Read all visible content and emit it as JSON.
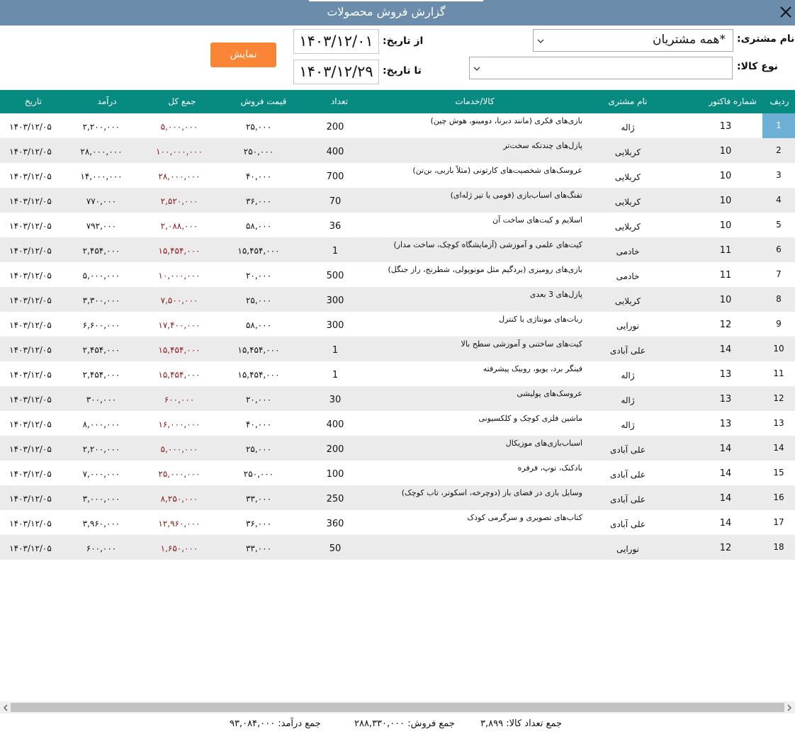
{
  "window": {
    "title": "گزارش فروش محصولات",
    "close_icon": "close-icon"
  },
  "filters": {
    "customer_label": "نام مشتری:",
    "customer_value": "*همه مشتریان",
    "product_type_label": "نوع کالا:",
    "product_type_value": "",
    "from_date_label": "از تاریخ:",
    "from_date_value": "۱۴۰۳/۱۲/۰۱",
    "to_date_label": "تا تاریخ:",
    "to_date_value": "۱۴۰۳/۱۲/۲۹",
    "show_button": "نمایش"
  },
  "table": {
    "headers": {
      "radif": "ردیف",
      "invoice": "شماره فاکتور",
      "customer": "نام مشتری",
      "product": "کالا/خدمات",
      "qty": "تعداد",
      "price": "قیمت فروش",
      "total": "جمع کل",
      "income": "درآمد",
      "date": "تاریخ"
    },
    "selected_row": 0,
    "rows": [
      {
        "radif": "1",
        "invoice": "13",
        "customer": "ژاله",
        "product": "بازی‌های فکری (مانند دبرنا، دومینو، هوش چین)",
        "qty": "200",
        "price": "۲۵,۰۰۰",
        "total": "۵,۰۰۰,۰۰۰",
        "income": "۲,۲۰۰,۰۰۰",
        "date": "۱۴۰۳/۱۲/۰۵"
      },
      {
        "radif": "2",
        "invoice": "10",
        "customer": "کربلایی",
        "product": "پازل‌های چندتکه سخت‌تر",
        "qty": "400",
        "price": "۲۵۰,۰۰۰",
        "total": "۱۰۰,۰۰۰,۰۰۰",
        "income": "۲۸,۰۰۰,۰۰۰",
        "date": "۱۴۰۳/۱۲/۰۵"
      },
      {
        "radif": "3",
        "invoice": "10",
        "customer": "کربلایی",
        "product": "عروسک‌های شخصیت‌های کارتونی (مثلاً باربی، بن‌تن)",
        "qty": "700",
        "price": "۴۰,۰۰۰",
        "total": "۲۸,۰۰۰,۰۰۰",
        "income": "۱۴,۰۰۰,۰۰۰",
        "date": "۱۴۰۳/۱۲/۰۵"
      },
      {
        "radif": "4",
        "invoice": "10",
        "customer": "کربلایی",
        "product": "تفنگ‌های اسباب‌بازی (فومی یا تیر ژله‌ای)",
        "qty": "70",
        "price": "۳۶,۰۰۰",
        "total": "۲,۵۲۰,۰۰۰",
        "income": "۷۷۰,۰۰۰",
        "date": "۱۴۰۳/۱۲/۰۵"
      },
      {
        "radif": "5",
        "invoice": "10",
        "customer": "کربلایی",
        "product": "اسلایم و کیت‌های ساخت آن",
        "qty": "36",
        "price": "۵۸,۰۰۰",
        "total": "۲,۰۸۸,۰۰۰",
        "income": "۷۹۲,۰۰۰",
        "date": "۱۴۰۳/۱۲/۰۵"
      },
      {
        "radif": "6",
        "invoice": "11",
        "customer": "خادمی",
        "product": "کیت‌های علمی و آموزشی (آزمایشگاه کوچک، ساخت مدار)",
        "qty": "1",
        "price": "۱۵,۴۵۴,۰۰۰",
        "total": "۱۵,۴۵۴,۰۰۰",
        "income": "۲,۴۵۴,۰۰۰",
        "date": "۱۴۰۳/۱۲/۰۵"
      },
      {
        "radif": "7",
        "invoice": "11",
        "customer": "خادمی",
        "product": "بازی‌های رومیزی (بردگیم مثل مونوپولی، شطرنج، راز جنگل)",
        "qty": "500",
        "price": "۲۰,۰۰۰",
        "total": "۱۰,۰۰۰,۰۰۰",
        "income": "۵,۰۰۰,۰۰۰",
        "date": "۱۴۰۳/۱۲/۰۵"
      },
      {
        "radif": "8",
        "invoice": "10",
        "customer": "کربلایی",
        "product": "پازل‌های 3 بعدی",
        "qty": "300",
        "price": "۲۵,۰۰۰",
        "total": "۷,۵۰۰,۰۰۰",
        "income": "۳,۳۰۰,۰۰۰",
        "date": "۱۴۰۳/۱۲/۰۵"
      },
      {
        "radif": "9",
        "invoice": "12",
        "customer": "نورایی",
        "product": "ربات‌های مونتاژی با کنترل",
        "qty": "300",
        "price": "۵۸,۰۰۰",
        "total": "۱۷,۴۰۰,۰۰۰",
        "income": "۶,۶۰۰,۰۰۰",
        "date": "۱۴۰۳/۱۲/۰۵"
      },
      {
        "radif": "10",
        "invoice": "14",
        "customer": "علی آبادی",
        "product": "کیت‌های ساختنی و آموزشی سطح بالا",
        "qty": "1",
        "price": "۱۵,۴۵۴,۰۰۰",
        "total": "۱۵,۴۵۴,۰۰۰",
        "income": "۲,۴۵۴,۰۰۰",
        "date": "۱۴۰۳/۱۲/۰۵"
      },
      {
        "radif": "11",
        "invoice": "13",
        "customer": "ژاله",
        "product": "فینگر برد، یویو، روبیک پیشرفته",
        "qty": "1",
        "price": "۱۵,۴۵۴,۰۰۰",
        "total": "۱۵,۴۵۴,۰۰۰",
        "income": "۲,۴۵۴,۰۰۰",
        "date": "۱۴۰۳/۱۲/۰۵"
      },
      {
        "radif": "12",
        "invoice": "13",
        "customer": "ژاله",
        "product": "عروسک‌های پولیشی",
        "qty": "30",
        "price": "۲۰,۰۰۰",
        "total": "۶۰۰,۰۰۰",
        "income": "۳۰۰,۰۰۰",
        "date": "۱۴۰۳/۱۲/۰۵"
      },
      {
        "radif": "13",
        "invoice": "13",
        "customer": "ژاله",
        "product": "ماشین فلزی کوچک و کلکسیونی",
        "qty": "400",
        "price": "۴۰,۰۰۰",
        "total": "۱۶,۰۰۰,۰۰۰",
        "income": "۸,۰۰۰,۰۰۰",
        "date": "۱۴۰۳/۱۲/۰۵"
      },
      {
        "radif": "14",
        "invoice": "14",
        "customer": "علی آبادی",
        "product": "اسباب‌بازی‌های موزیکال",
        "qty": "200",
        "price": "۲۵,۰۰۰",
        "total": "۵,۰۰۰,۰۰۰",
        "income": "۲,۲۰۰,۰۰۰",
        "date": "۱۴۰۳/۱۲/۰۵"
      },
      {
        "radif": "15",
        "invoice": "14",
        "customer": "علی آبادی",
        "product": "بادکنک، توپ، فرفره",
        "qty": "100",
        "price": "۲۵۰,۰۰۰",
        "total": "۲۵,۰۰۰,۰۰۰",
        "income": "۷,۰۰۰,۰۰۰",
        "date": "۱۴۰۳/۱۲/۰۵"
      },
      {
        "radif": "16",
        "invoice": "14",
        "customer": "علی آبادی",
        "product": "وسایل بازی در فضای باز (دوچرخه، اسکوتر، تاب کوچک)",
        "qty": "250",
        "price": "۳۳,۰۰۰",
        "total": "۸,۲۵۰,۰۰۰",
        "income": "۳,۰۰۰,۰۰۰",
        "date": "۱۴۰۳/۱۲/۰۵"
      },
      {
        "radif": "17",
        "invoice": "14",
        "customer": "علی آبادی",
        "product": "کتاب‌های تصویری و سرگرمی کودک",
        "qty": "360",
        "price": "۳۶,۰۰۰",
        "total": "۱۲,۹۶۰,۰۰۰",
        "income": "۳,۹۶۰,۰۰۰",
        "date": "۱۴۰۳/۱۲/۰۵"
      },
      {
        "radif": "18",
        "invoice": "12",
        "customer": "نورایی",
        "product": "",
        "qty": "50",
        "price": "۳۳,۰۰۰",
        "total": "۱,۶۵۰,۰۰۰",
        "income": "۶۰۰,۰۰۰",
        "date": "۱۴۰۳/۱۲/۰۵"
      }
    ]
  },
  "footer": {
    "qty_label": "جمع تعداد کالا:",
    "qty_value": "۳,۸۹۹",
    "sales_label": "جمع فروش:",
    "sales_value": "۲۸۸,۳۳۰,۰۰۰",
    "income_label": "جمع درآمد:",
    "income_value": "۹۳,۰۸۴,۰۰۰"
  },
  "colors": {
    "titlebar": "#6b8cab",
    "header": "#078a7f",
    "button": "#fb8537",
    "selected": "#6eafd6",
    "total_text": "#8b1a1a"
  }
}
